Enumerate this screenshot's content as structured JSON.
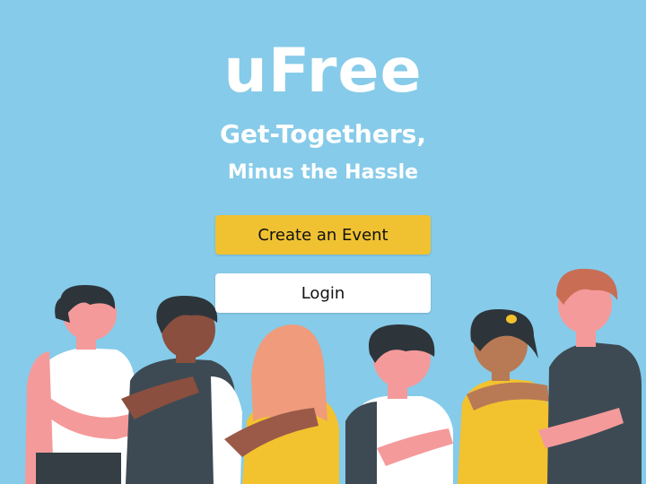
{
  "brand": {
    "name": "uFree",
    "tagline_line1": "Get-Togethers,",
    "tagline_line2": "Minus the Hassle"
  },
  "actions": {
    "create_event_label": "Create an Event",
    "login_label": "Login"
  },
  "colors": {
    "background": "#86cbe9",
    "primary_button": "#f0c232",
    "secondary_button": "#ffffff"
  }
}
